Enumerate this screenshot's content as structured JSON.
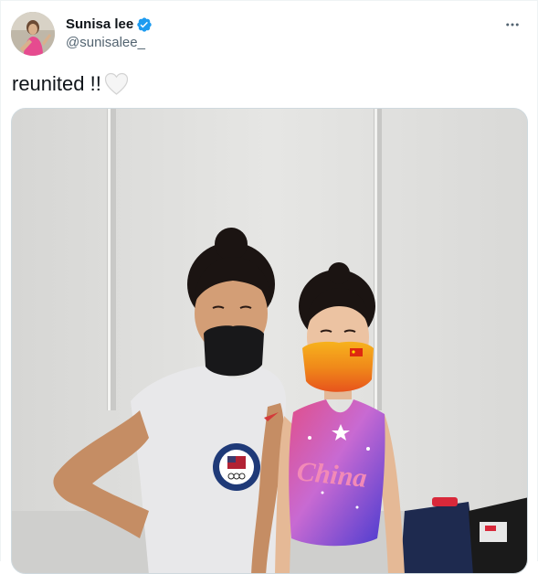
{
  "tweet": {
    "author": {
      "display_name": "Sunisa lee",
      "handle": "@sunisalee_",
      "verified": true,
      "verified_color": "#1d9bf0"
    },
    "text": "reunited !!",
    "emoji": "white-heart",
    "more_icon": "more-horizontal-icon",
    "media": {
      "type": "photo",
      "shirt_text": "UNITED STATES OLYMPIC",
      "leotard_text": "China"
    }
  },
  "colors": {
    "text_primary": "#0f1419",
    "text_secondary": "#536471",
    "border": "#cfd9de"
  }
}
